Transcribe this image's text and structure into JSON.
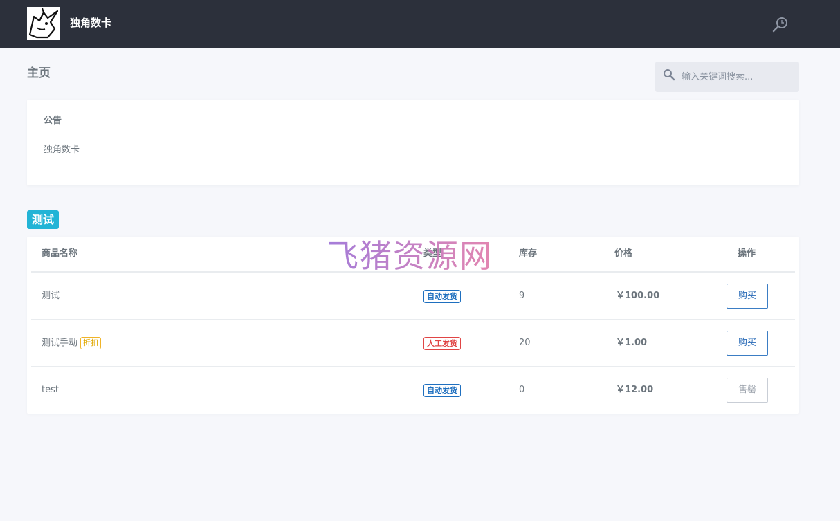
{
  "header": {
    "brand": "独角数卡",
    "logo_icon": "unicorn-logo-icon",
    "search_icon": "search-icon"
  },
  "page": {
    "title": "主页",
    "search_placeholder": "输入关键词搜索..."
  },
  "notice": {
    "title": "公告",
    "body": "独角数卡"
  },
  "category": {
    "label": "测试",
    "color": "#22b4d6"
  },
  "table": {
    "headers": {
      "name": "商品名称",
      "type": "类型",
      "stock": "库存",
      "price": "价格",
      "action": "操作"
    },
    "rows": [
      {
        "name": "测试",
        "discount": "",
        "type": "自动发货",
        "stock": "9",
        "price": "￥100.00",
        "action": "购买"
      },
      {
        "name": "测试手动",
        "discount": "折扣",
        "type": "人工发货",
        "stock": "20",
        "price": "￥1.00",
        "action": "购买"
      },
      {
        "name": "test",
        "discount": "",
        "type": "自动发货",
        "stock": "0",
        "price": "￥12.00",
        "action": "售罄"
      }
    ]
  },
  "watermark": "飞猪资源网",
  "colors": {
    "header_bg": "#2c303b",
    "auto_delivery": "#1e6fbf",
    "manual_delivery": "#e04545",
    "discount": "#e0a800",
    "buy_button": "#2b6cb8"
  }
}
